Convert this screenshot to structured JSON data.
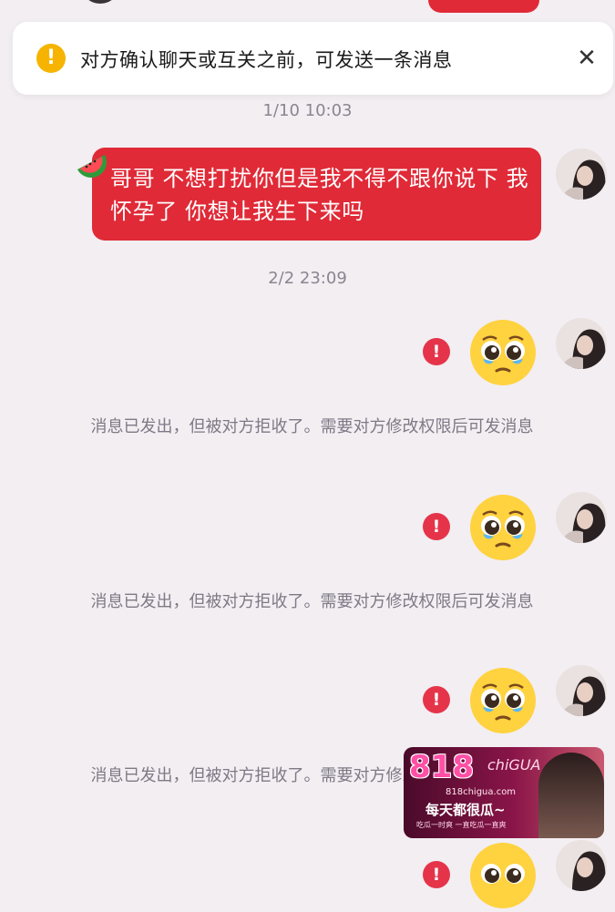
{
  "banner": {
    "icon": "warning-icon",
    "text": "对方确认聊天或互关之前，可发送一条消息",
    "close_glyph": "✕"
  },
  "timestamps": [
    "1/10 10:03",
    "2/2 23:09"
  ],
  "first_message": {
    "text": "哥哥 不想打扰你但是我不得不跟你说下 我怀孕了 你想让我生下来吗",
    "decoration": "watermelon-icon"
  },
  "sent_emojis": [
    {
      "emoji": "pleading-face",
      "status": "rejected"
    },
    {
      "emoji": "pleading-face",
      "status": "rejected"
    },
    {
      "emoji": "pleading-face",
      "status": "rejected"
    },
    {
      "emoji": "pleading-face",
      "status": "rejected"
    }
  ],
  "error_glyph": "!",
  "rejected_notice": "消息已发出，但被对方拒收了。需要对方修改权限后可发消息",
  "ad": {
    "logo": "818",
    "logo_sub": "chiGUA",
    "url": "818chigua.com",
    "slogan": "每天都很瓜~",
    "line": "吃瓜一时爽 一直吃瓜一直爽"
  },
  "colors": {
    "background": "#f2eef2",
    "bubble": "#e02a37",
    "warning": "#f6b400",
    "error": "#e5344a"
  }
}
